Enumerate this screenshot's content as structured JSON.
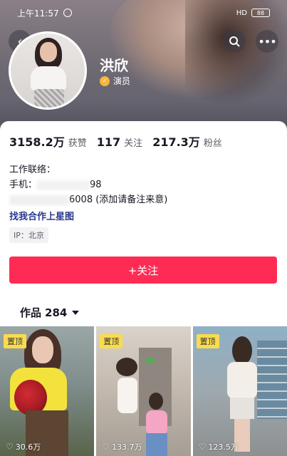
{
  "status_bar": {
    "time": "上午11:57",
    "right": "HD",
    "battery": "88"
  },
  "profile": {
    "name": "洪欣",
    "role": "演员",
    "stats": [
      {
        "value": "3158.2万",
        "label": "获赞"
      },
      {
        "value": "117",
        "label": "关注"
      },
      {
        "value": "217.3万",
        "label": "粉丝"
      }
    ],
    "bio": {
      "line1": "工作联络：",
      "line2_prefix": "手机：",
      "line2_suffix": "98",
      "line3_suffix": "6008 (添加请备注来意)"
    },
    "link": "找我合作上星图",
    "ip": "IP：北京",
    "follow_button": "+关注"
  },
  "works": {
    "tab_label": "作品",
    "count": "284",
    "items": [
      {
        "pin": "置顶",
        "likes": "30.6万"
      },
      {
        "pin": "置顶",
        "likes": "133.7万"
      },
      {
        "pin": "置顶",
        "likes": "123.5万"
      }
    ]
  },
  "colors": {
    "accent": "#fe2c55",
    "pin": "#fadb4e",
    "link": "#2a3a8f"
  },
  "icons": [
    "back-arrow-icon",
    "search-icon",
    "more-icon",
    "verified-icon",
    "heart-icon",
    "caret-down-icon"
  ]
}
